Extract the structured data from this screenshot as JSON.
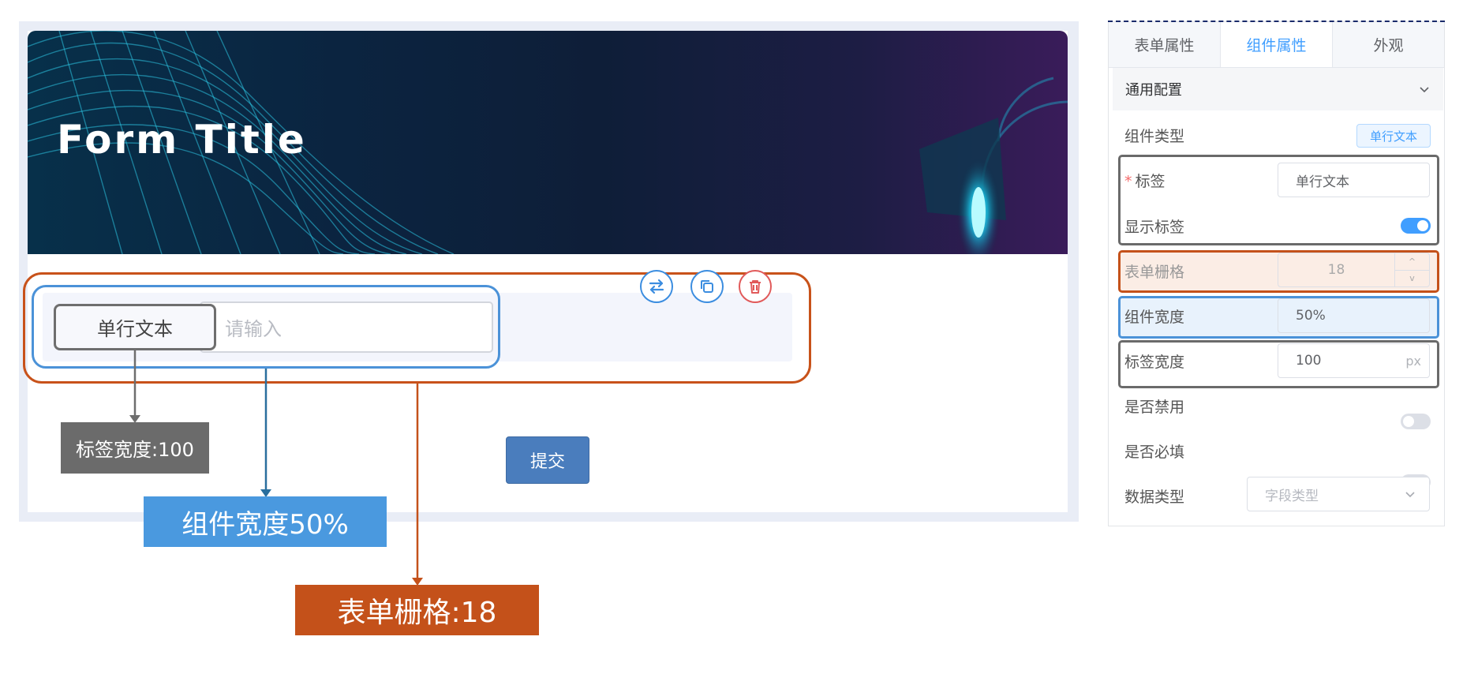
{
  "banner": {
    "title": "Form Title"
  },
  "field": {
    "label": "单行文本",
    "placeholder": "请输入"
  },
  "toolbar": {
    "switch_icon": "swap-icon",
    "copy_icon": "copy-icon",
    "delete_icon": "trash-icon"
  },
  "form": {
    "submit_label": "提交"
  },
  "annotations": {
    "label_width": "标签宽度:100",
    "component_width": "组件宽度50%",
    "form_grid": "表单栅格:18"
  },
  "panel": {
    "tabs": [
      {
        "label": "表单属性",
        "active": false
      },
      {
        "label": "组件属性",
        "active": true
      },
      {
        "label": "外观",
        "active": false
      }
    ],
    "section": {
      "title": "通用配置"
    },
    "props": {
      "component_type": {
        "label": "组件类型",
        "value": "单行文本"
      },
      "label": {
        "required_mark": "*",
        "label": "标签",
        "value": "单行文本"
      },
      "show_label": {
        "label": "显示标签",
        "on": true
      },
      "form_grid": {
        "label": "表单栅格",
        "value": "18",
        "up": "^",
        "down": "v"
      },
      "component_width": {
        "label": "组件宽度",
        "value": "50%"
      },
      "label_width": {
        "label": "标签宽度",
        "value": "100",
        "suffix": "px"
      },
      "disabled": {
        "label": "是否禁用",
        "on": false
      },
      "required": {
        "label": "是否必填",
        "on": false
      },
      "data_type": {
        "label": "数据类型",
        "placeholder": "字段类型"
      }
    }
  },
  "colors": {
    "accent": "#409eff",
    "grid_annotation": "#c4511a",
    "width_annotation": "#4a99df",
    "label_annotation": "#6b6b6b",
    "submit": "#4a7dbd"
  }
}
